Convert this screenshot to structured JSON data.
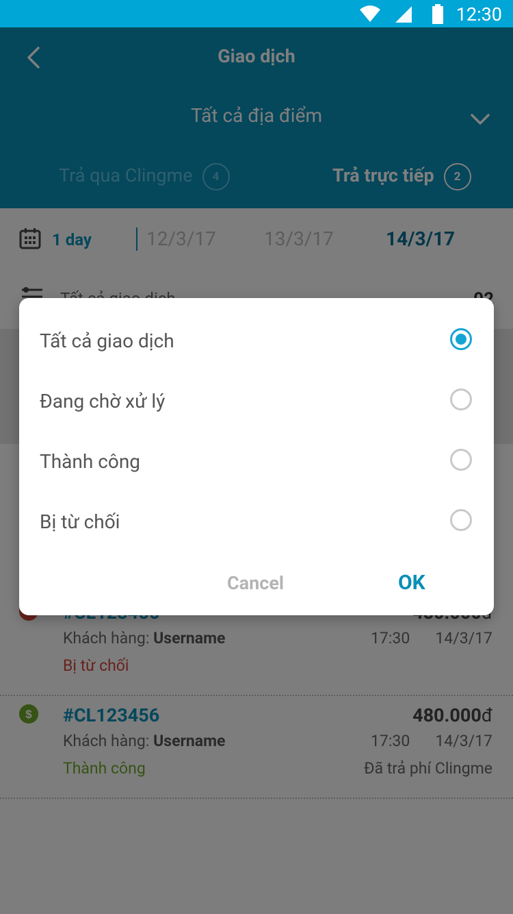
{
  "statusbar": {
    "time": "12:30"
  },
  "header": {
    "title": "Giao dịch",
    "location": "Tất cả địa điểm",
    "tabs": [
      {
        "label": "Trả qua Clingme",
        "count": "4"
      },
      {
        "label": "Trả trực tiếp",
        "count": "2"
      }
    ]
  },
  "daterow": {
    "range_label": "1 day",
    "dates": [
      "12/3/17",
      "13/3/17",
      "14/3/17"
    ]
  },
  "filter": {
    "label": "Tất cả giao dịch",
    "count": "02"
  },
  "list": [
    {
      "code": "#CL123456",
      "amount": "480.000",
      "currency": "đ",
      "customer_label": "Khách hàng: ",
      "customer": "Username",
      "time": "17:30",
      "date": "14/3/17",
      "status": "Bị từ chối",
      "fee": ""
    },
    {
      "code": "#CL123456",
      "amount": "480.000",
      "currency": "đ",
      "customer_label": "Khách hàng: ",
      "customer": "Username",
      "time": "17:30",
      "date": "14/3/17",
      "status": "Thành công",
      "fee": "Đã trả phí Clingme"
    }
  ],
  "dialog": {
    "options": [
      {
        "label": "Tất cả giao dịch",
        "selected": true
      },
      {
        "label": "Đang chờ xử lý",
        "selected": false
      },
      {
        "label": "Thành công",
        "selected": false
      },
      {
        "label": "Bị từ chối",
        "selected": false
      }
    ],
    "cancel_label": "Cancel",
    "ok_label": "OK"
  },
  "colors": {
    "statusbar": "#00a6d6",
    "header": "#0a8fb6",
    "accent": "#14a5d4",
    "rejected": "#d0453b",
    "success": "#6ea72a"
  }
}
